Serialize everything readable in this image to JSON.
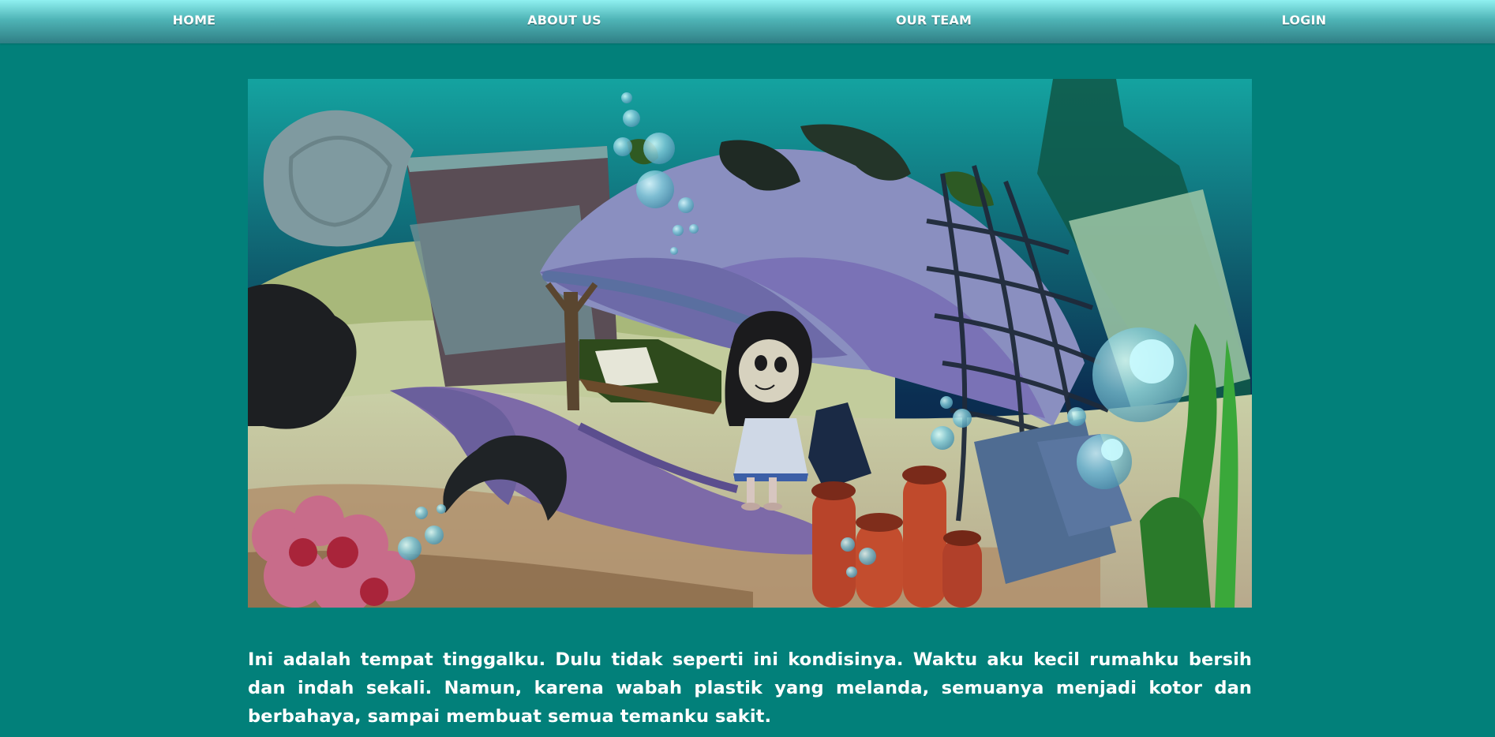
{
  "nav": {
    "items": [
      {
        "label": "HOME"
      },
      {
        "label": "ABOUT US"
      },
      {
        "label": "OUR TEAM"
      },
      {
        "label": "LOGIN"
      }
    ]
  },
  "hero": {
    "image": "underwater-polluted-home-illustration"
  },
  "story": {
    "text": "Ini adalah tempat tinggalku. Dulu tidak seperti ini kondisinya. Waktu aku kecil rumahku bersih dan indah sekali. Namun, karena wabah plastik yang melanda, semuanya menjadi kotor dan berbahaya, sampai membuat semua temanku sakit."
  },
  "colors": {
    "page_background": "#02807a",
    "nav_top": "#8ff0f0",
    "nav_bottom": "#2f7f85",
    "text": "#ffffff"
  }
}
